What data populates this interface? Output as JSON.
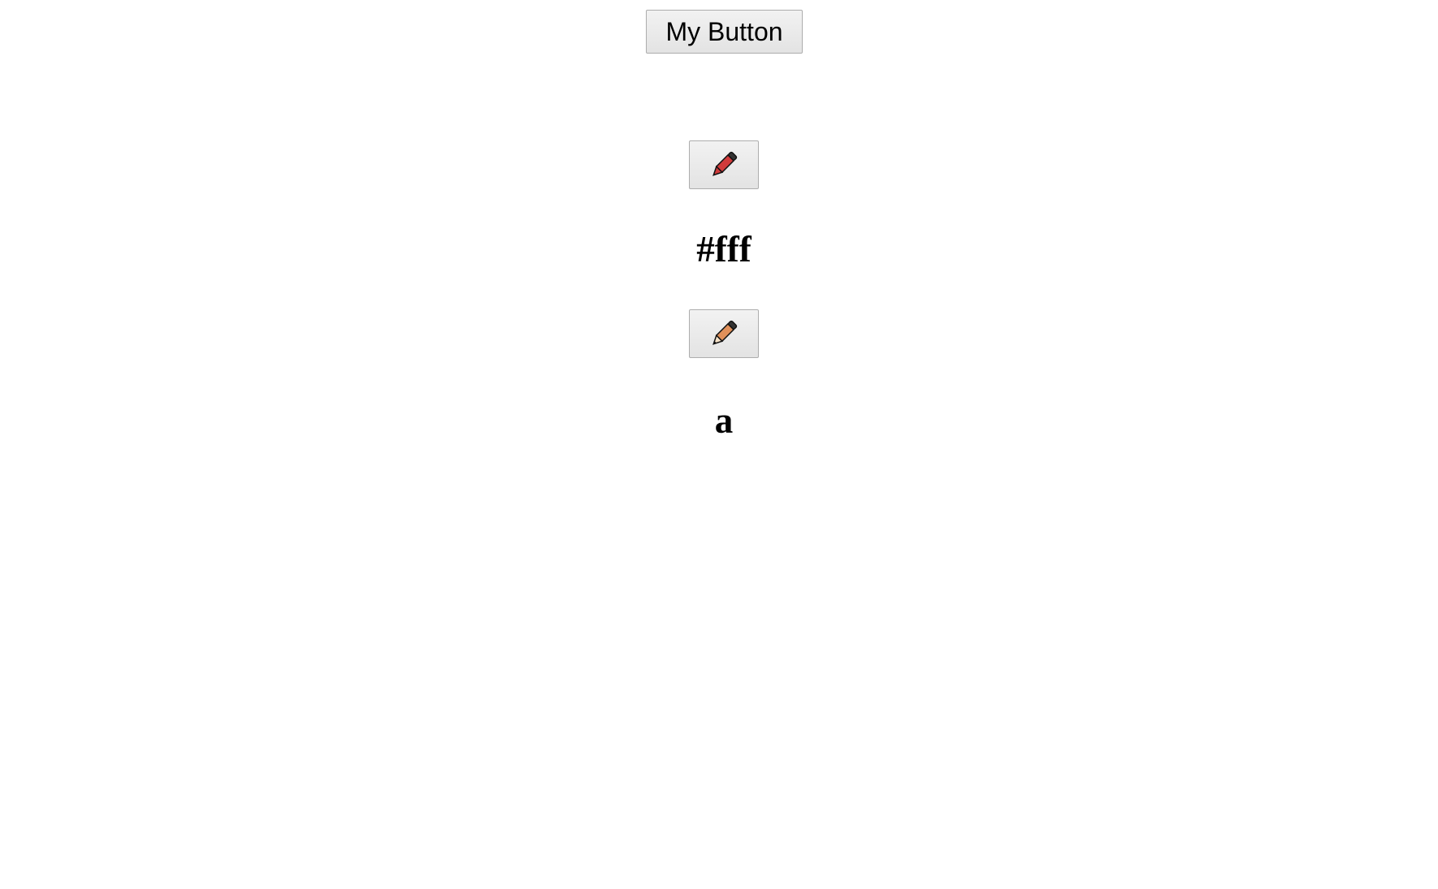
{
  "buttons": {
    "my_button_label": "My Button"
  },
  "icons": {
    "first": "pencil-icon-red",
    "second": "pencil-icon-orange"
  },
  "headings": {
    "first": "#fff",
    "second": "a"
  },
  "colors": {
    "pencil_red": "#d13b3b",
    "pencil_orange": "#e0905a"
  }
}
